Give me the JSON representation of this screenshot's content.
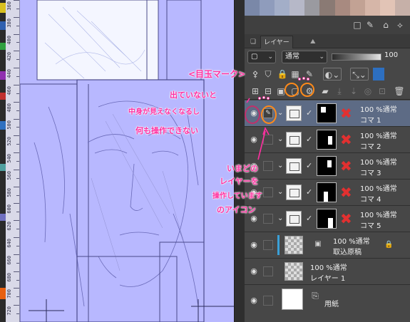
{
  "ruler": {
    "labels": [
      "360",
      "380",
      "400",
      "420",
      "440",
      "460",
      "480",
      "500",
      "520",
      "540",
      "560",
      "580",
      "600",
      "620",
      "640",
      "660",
      "680",
      "700",
      "720"
    ]
  },
  "palette": [
    "#7a88a8",
    "#8f9cbc",
    "#a3aec8",
    "#b6b8c8",
    "#9a9aa0",
    "#8a7a74",
    "#a88a80",
    "#c2a294",
    "#d6b6a8",
    "#e2c4b6",
    "#c6b0a8"
  ],
  "panel_tabs": {
    "layer_tab": "レイヤー"
  },
  "blend": {
    "mode": "通常",
    "opacity": "100"
  },
  "layers": [
    {
      "line1": "100 %通常",
      "line2": "コマ 1"
    },
    {
      "line1": "100 %通常",
      "line2": "コマ 2"
    },
    {
      "line1": "100 %通常",
      "line2": "コマ 3"
    },
    {
      "line1": "100 %通常",
      "line2": "コマ 4"
    },
    {
      "line1": "100 %通常",
      "line2": "コマ 5"
    },
    {
      "line1": "100 %通常",
      "line2": "取込原稿"
    },
    {
      "line1": "100 %通常",
      "line2": "レイヤー 1"
    },
    {
      "line1": "",
      "line2": "用紙"
    }
  ],
  "annotations": {
    "eye_title": "<目玉マーク>",
    "eye_note_1": "出ていないと",
    "eye_note_2": "中身が見えなくなるし",
    "eye_note_3": "何も操作できない",
    "pen_note_1": "いまどの",
    "pen_note_2": "レイヤーを",
    "pen_note_3": "操作しています",
    "pen_note_4": "のアイコン"
  },
  "colors": {
    "annotation": "#ff2fa0",
    "eye_circle": "#c0306a",
    "icon_circle": "#ff8a1a",
    "selected_layer": "#5d6b85",
    "canvas": "#b8b8ff"
  }
}
